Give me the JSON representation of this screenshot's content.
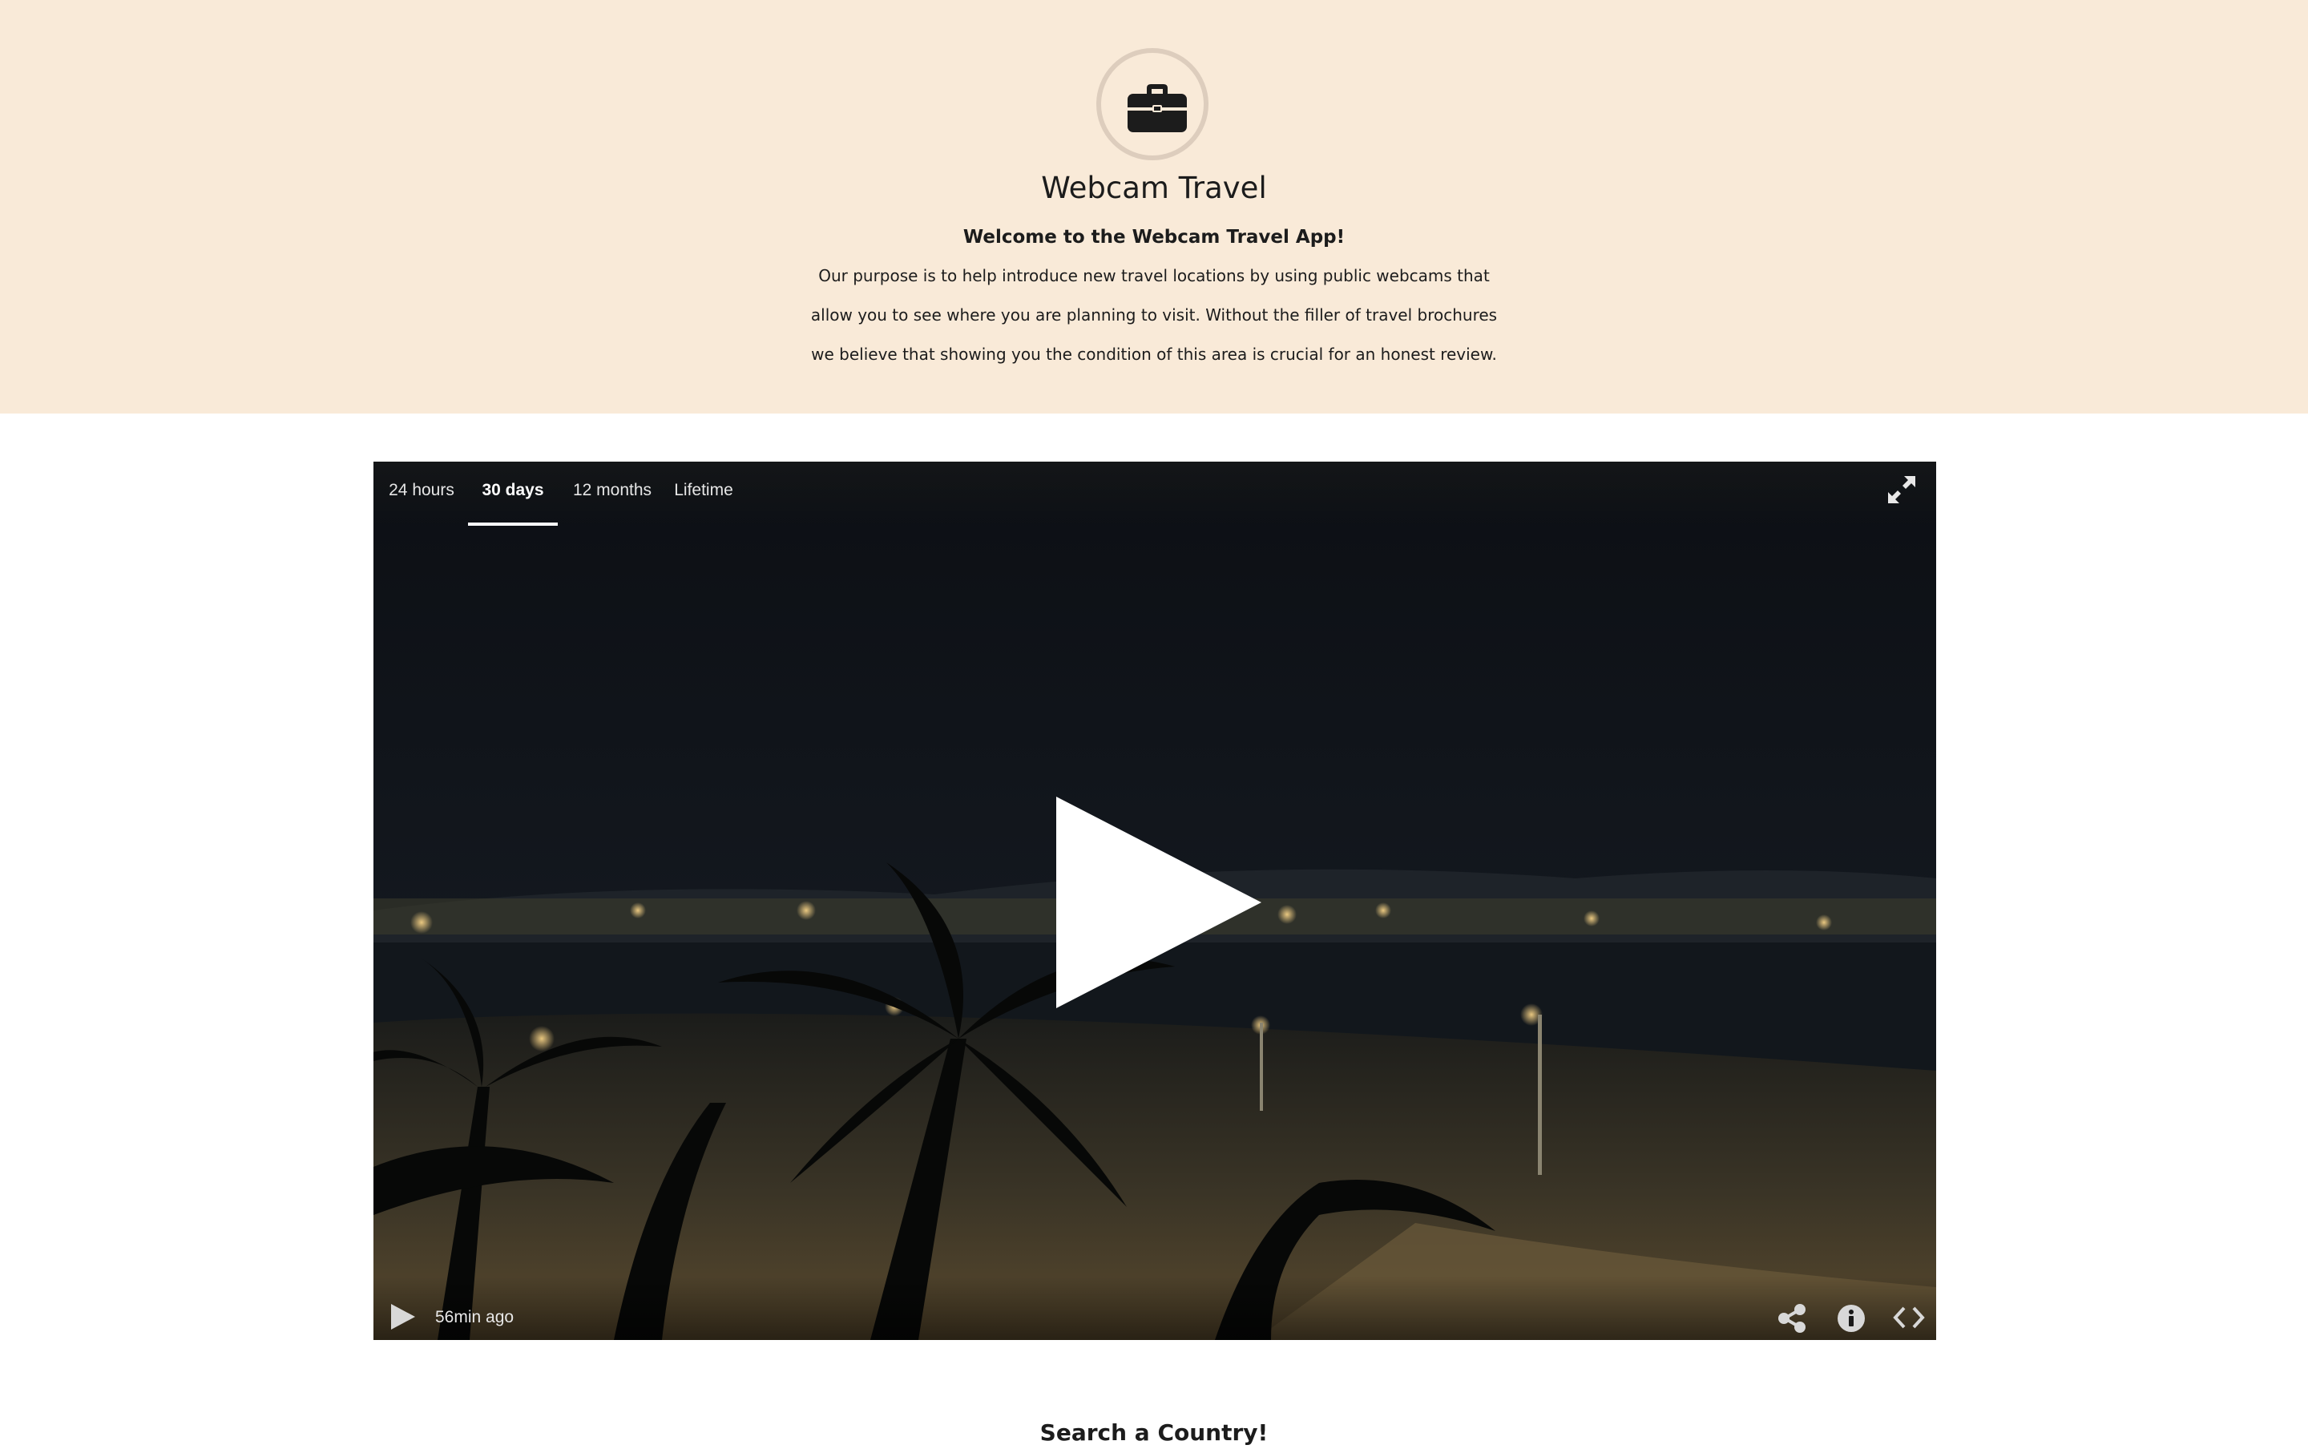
{
  "header": {
    "logo_icon": "briefcase-icon",
    "title": "Webcam Travel",
    "welcome": "Welcome to the Webcam Travel App!",
    "description_lines": [
      "Our purpose is to help introduce new travel locations by using public webcams that",
      "allow you to see where you are planning to visit. Without the filler of travel brochures",
      "we believe that showing you the condition of this area is crucial for an honest review."
    ],
    "background_color": "#f9ead8"
  },
  "player": {
    "tabs": [
      {
        "label": "24 hours",
        "active": false
      },
      {
        "label": "30 days",
        "active": true
      },
      {
        "label": "12 months",
        "active": false
      },
      {
        "label": "Lifetime",
        "active": false
      }
    ],
    "last_update": "56min ago",
    "icons": [
      "fullscreen-icon",
      "big-play-icon",
      "play-icon",
      "share-icon",
      "info-icon",
      "embed-code-icon"
    ]
  },
  "search": {
    "title": "Search a Country!"
  }
}
